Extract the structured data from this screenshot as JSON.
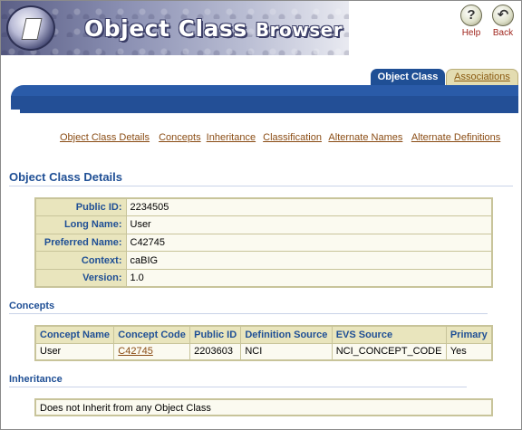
{
  "banner": {
    "title_main": "Object Class",
    "title_sub": "Browser"
  },
  "toolbar": {
    "help_label": "Help",
    "back_label": "Back",
    "help_glyph": "?",
    "back_glyph": "↶"
  },
  "tabs": {
    "active": "Object Class",
    "inactive": "Associations"
  },
  "sublinks": [
    "Object Class Details",
    "Concepts",
    "Inheritance",
    "Classification",
    "Alternate Names",
    "Alternate Definitions"
  ],
  "details": {
    "heading": "Object Class Details",
    "rows": [
      {
        "label": "Public ID:",
        "value": "2234505"
      },
      {
        "label": "Long Name:",
        "value": "User"
      },
      {
        "label": "Preferred Name:",
        "value": "C42745"
      },
      {
        "label": "Context:",
        "value": "caBIG"
      },
      {
        "label": "Version:",
        "value": "1.0"
      }
    ]
  },
  "concepts": {
    "heading": "Concepts",
    "columns": [
      "Concept Name",
      "Concept Code",
      "Public ID",
      "Definition Source",
      "EVS Source",
      "Primary"
    ],
    "rows": [
      {
        "name": "User",
        "code": "C42745",
        "public_id": "2203603",
        "definition_source": "NCI",
        "evs_source": "NCI_CONCEPT_CODE",
        "primary": "Yes"
      }
    ]
  },
  "inheritance": {
    "heading": "Inheritance",
    "text": "Does not Inherit from any Object Class"
  },
  "colors": {
    "accent_blue": "#1f4f95",
    "link_brown": "#8a4c14",
    "table_header": "#e9e5bd",
    "table_border": "#c8c49a"
  }
}
